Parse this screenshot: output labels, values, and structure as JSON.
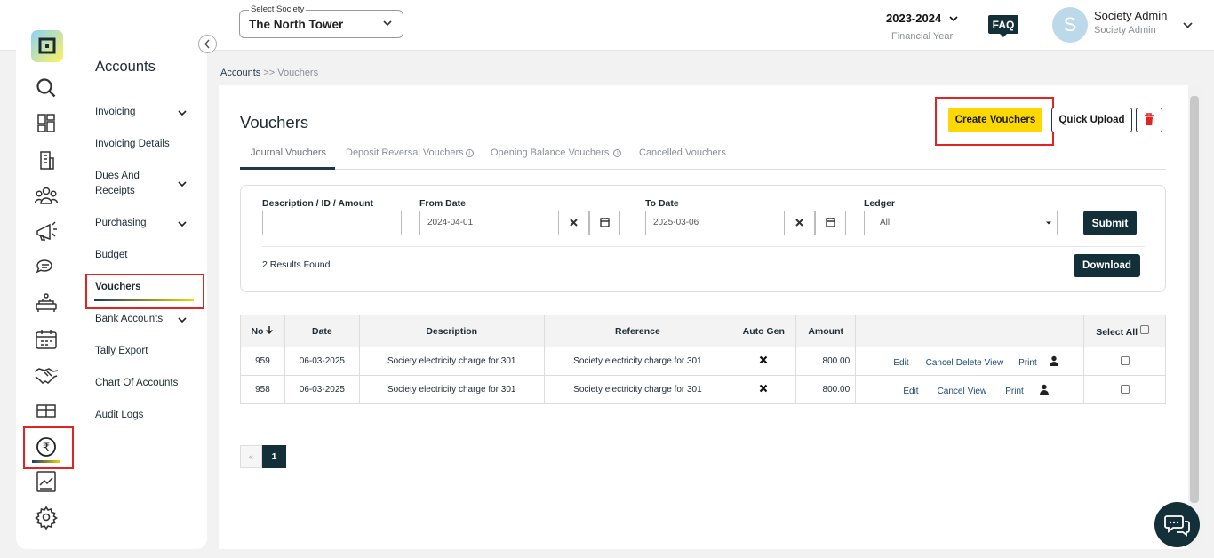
{
  "header": {
    "society_label": "Select Society",
    "society_value": "The North Tower",
    "financial_year": "2023-2024",
    "financial_year_label": "Financial Year",
    "faq_label": "FAQ",
    "avatar_letter": "S",
    "user_name": "Society Admin",
    "user_role": "Society Admin"
  },
  "sidebar": {
    "title": "Accounts",
    "items": [
      {
        "label": "Invoicing",
        "expandable": true
      },
      {
        "label": "Invoicing Details",
        "expandable": false
      },
      {
        "label": "Dues And Receipts",
        "expandable": true
      },
      {
        "label": "Purchasing",
        "expandable": true
      },
      {
        "label": "Budget",
        "expandable": false
      },
      {
        "label": "Vouchers",
        "expandable": false,
        "active": true
      },
      {
        "label": "Bank Accounts",
        "expandable": true
      },
      {
        "label": "Tally Export",
        "expandable": false
      },
      {
        "label": "Chart Of Accounts",
        "expandable": false
      },
      {
        "label": "Audit Logs",
        "expandable": false
      }
    ],
    "rail_icons": [
      "search-icon",
      "dashboard-icon",
      "building-icon",
      "members-icon",
      "announcement-icon",
      "chat-icon",
      "amenity-icon",
      "calendar-icon",
      "handshake-icon",
      "gift-icon",
      "rupee-icon",
      "report-icon",
      "settings-icon"
    ]
  },
  "breadcrumb": {
    "root": "Accounts",
    "sep": ">>",
    "current": "Vouchers"
  },
  "page": {
    "title": "Vouchers",
    "create_btn": "Create Vouchers",
    "upload_btn": "Quick Upload",
    "tabs": [
      "Journal Vouchers",
      "Deposit Reversal Vouchers",
      "Opening Balance Vouchers",
      "Cancelled Vouchers"
    ],
    "info_glyph": "i"
  },
  "filters": {
    "desc_label": "Description / ID / Amount",
    "desc_value": "",
    "from_label": "From Date",
    "from_value": "2024-04-01",
    "to_label": "To Date",
    "to_value": "2025-03-06",
    "ledger_label": "Ledger",
    "ledger_value": "All",
    "submit": "Submit",
    "results": "2 Results Found",
    "download": "Download"
  },
  "table": {
    "headers": {
      "no": "No",
      "date": "Date",
      "description": "Description",
      "reference": "Reference",
      "auto_gen": "Auto Gen",
      "amount": "Amount",
      "actions": "",
      "select_all": "Select All"
    },
    "rows": [
      {
        "no": "959",
        "date": "06-03-2025",
        "description": "Society electricity charge for 301",
        "reference": "Society electricity charge for 301",
        "amount": "800.00",
        "actions": [
          "Edit",
          "Cancel",
          "Delete",
          "View",
          "Print"
        ]
      },
      {
        "no": "958",
        "date": "06-03-2025",
        "description": "Society electricity charge for 301",
        "reference": "Society electricity charge for 301",
        "amount": "800.00",
        "actions": [
          "Edit",
          "Cancel",
          "View",
          "Print"
        ]
      }
    ]
  },
  "pagination": {
    "prev": "«",
    "current": "1"
  },
  "colors": {
    "accent": "#fcd800",
    "dark": "#133038",
    "highlight": "#e02424"
  }
}
